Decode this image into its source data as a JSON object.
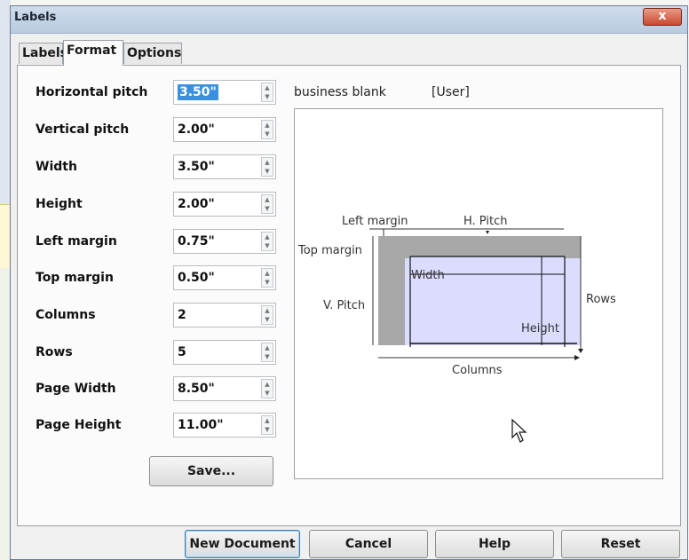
{
  "window": {
    "title": "Labels",
    "close_glyph": "x"
  },
  "tabs": [
    {
      "label": "Labels"
    },
    {
      "label": "Format"
    },
    {
      "label": "Options"
    }
  ],
  "active_tab": "Format",
  "fields": {
    "horizontal_pitch": {
      "label": "Horizontal pitch",
      "value": "3.50\""
    },
    "vertical_pitch": {
      "label": "Vertical pitch",
      "value": "2.00\""
    },
    "width": {
      "label": "Width",
      "value": "3.50\""
    },
    "height": {
      "label": "Height",
      "value": "2.00\""
    },
    "left_margin": {
      "label": "Left margin",
      "value": "0.75\""
    },
    "top_margin": {
      "label": "Top margin",
      "value": "0.50\""
    },
    "columns": {
      "label": "Columns",
      "value": "2"
    },
    "rows": {
      "label": "Rows",
      "value": "5"
    },
    "page_width": {
      "label": "Page Width",
      "value": "8.50\""
    },
    "page_height": {
      "label": "Page Height",
      "value": "11.00\""
    }
  },
  "save_label": "Save...",
  "format": {
    "name": "business blank",
    "type": "[User]"
  },
  "diagram": {
    "left_margin": "Left margin",
    "h_pitch": "H. Pitch",
    "top_margin": "Top margin",
    "width": "Width",
    "v_pitch": "V. Pitch",
    "rows": "Rows",
    "height": "Height",
    "columns": "Columns",
    "label_fill": "#dcdcff",
    "margin_fill": "#a8a8a8"
  },
  "buttons": {
    "new_document": "New Document",
    "cancel": "Cancel",
    "help": "Help",
    "reset": "Reset"
  },
  "icons": {
    "close": "close-icon",
    "spin_up": "spin-up-icon",
    "spin_down": "spin-down-icon",
    "cursor": "mouse-pointer-icon"
  }
}
